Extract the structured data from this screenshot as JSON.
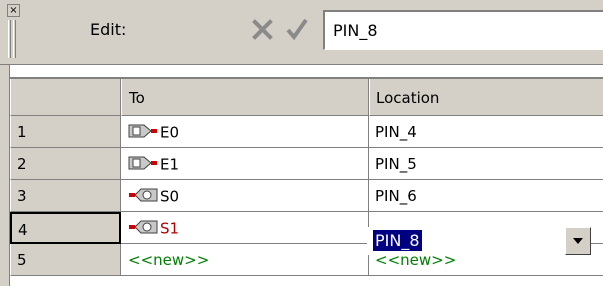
{
  "toolbar": {
    "edit_label": "Edit:",
    "edit_value": "PIN_8",
    "cancel_icon": "x-icon",
    "accept_icon": "checkmark-icon"
  },
  "grid": {
    "columns": [
      "",
      "To",
      "Location"
    ],
    "rows": [
      {
        "num": "1",
        "to": "E0",
        "location": "PIN_4",
        "pin_type": "input"
      },
      {
        "num": "2",
        "to": "E1",
        "location": "PIN_5",
        "pin_type": "input"
      },
      {
        "num": "3",
        "to": "S0",
        "location": "PIN_6",
        "pin_type": "output"
      },
      {
        "num": "4",
        "to": "S1",
        "location": "PIN_8",
        "pin_type": "output"
      },
      {
        "num": "5",
        "to": "<<new>>",
        "location": "<<new>>",
        "pin_type": "none"
      }
    ]
  },
  "colors": {
    "chrome": "#d4d0c8",
    "selection": "#000080",
    "new_text": "#008000",
    "current_text": "#b00000"
  }
}
